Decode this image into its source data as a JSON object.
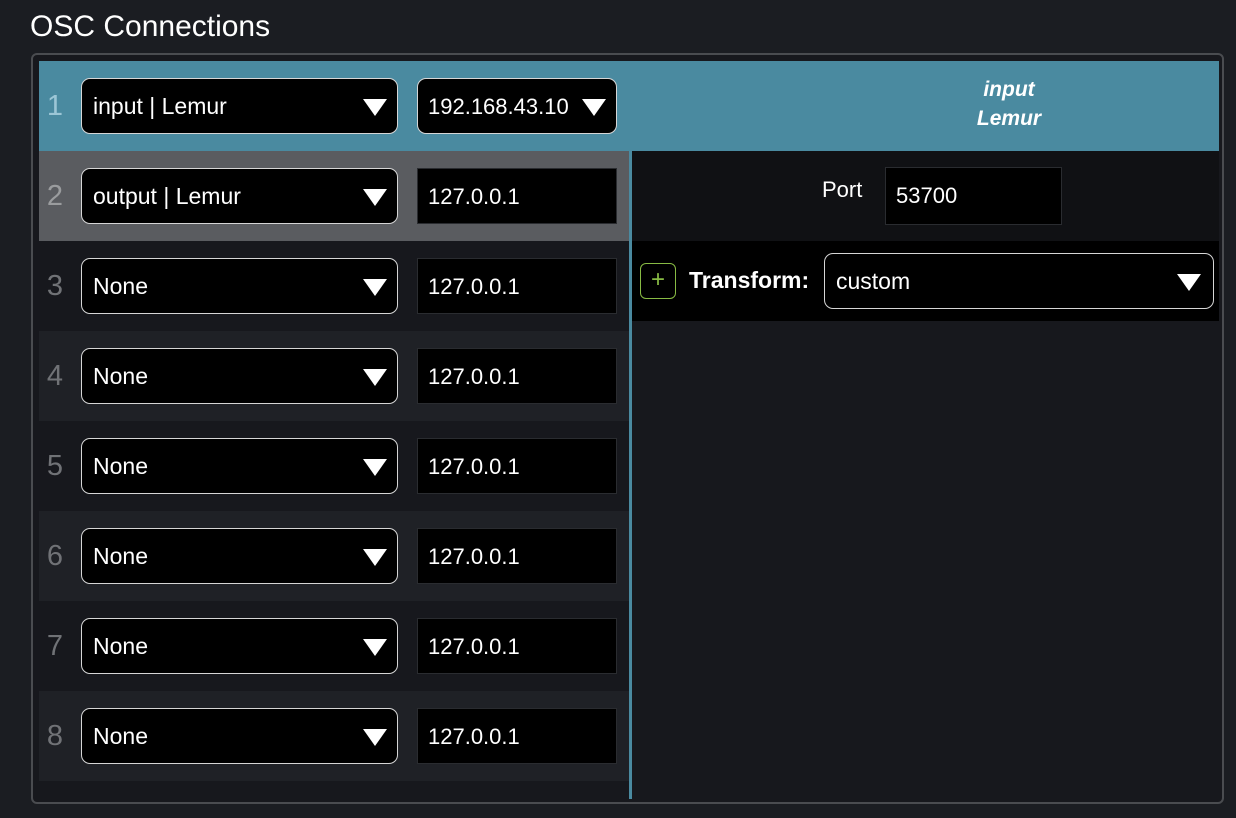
{
  "title": "OSC Connections",
  "rows": [
    {
      "num": "1",
      "device": "input | Lemur",
      "ip": "192.168.43.10"
    },
    {
      "num": "2",
      "device": "output | Lemur",
      "ip": "127.0.0.1"
    },
    {
      "num": "3",
      "device": "None",
      "ip": "127.0.0.1"
    },
    {
      "num": "4",
      "device": "None",
      "ip": "127.0.0.1"
    },
    {
      "num": "5",
      "device": "None",
      "ip": "127.0.0.1"
    },
    {
      "num": "6",
      "device": "None",
      "ip": "127.0.0.1"
    },
    {
      "num": "7",
      "device": "None",
      "ip": "127.0.0.1"
    },
    {
      "num": "8",
      "device": "None",
      "ip": "127.0.0.1"
    }
  ],
  "active_row": {
    "line1": "input",
    "line2": "Lemur"
  },
  "port": {
    "label": "Port",
    "value": "53700"
  },
  "transform": {
    "add_label": "+",
    "label": "Transform:",
    "value": "custom"
  },
  "colors": {
    "accent": "#4a8aa0",
    "selected": "#5a5c60",
    "add_button": "#88bb44"
  },
  "icons": {
    "dropdown": "caret-down-icon",
    "add": "plus-icon"
  }
}
